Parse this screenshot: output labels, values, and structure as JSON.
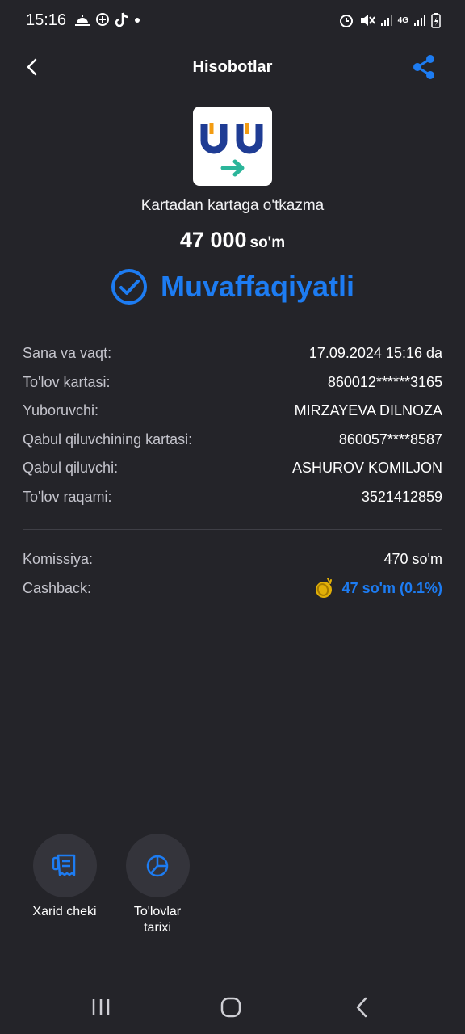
{
  "status_bar": {
    "time": "15:16",
    "network": "4G"
  },
  "header": {
    "title": "Hisobotlar"
  },
  "transaction": {
    "type": "Kartadan kartaga o'tkazma",
    "amount": "47 000",
    "currency": "so'm",
    "status": "Muvaffaqiyatli"
  },
  "details": [
    {
      "label": "Sana va vaqt:",
      "value": "17.09.2024 15:16 da"
    },
    {
      "label": "To'lov kartasi:",
      "value": "860012******3165"
    },
    {
      "label": "Yuboruvchi:",
      "value": "MIRZAYEVA DILNOZA"
    },
    {
      "label": "Qabul qiluvchining kartasi:",
      "value": "860057****8587"
    },
    {
      "label": "Qabul qiluvchi:",
      "value": "ASHUROV KOMILJON"
    },
    {
      "label": "To'lov raqami:",
      "value": "3521412859"
    }
  ],
  "fees": {
    "commission_label": "Komissiya:",
    "commission_value": "470 so'm",
    "cashback_label": "Cashback:",
    "cashback_value": "47 so'm (0.1%)"
  },
  "actions": {
    "receipt_label": "Xarid cheki",
    "history_label_1": "To'lovlar",
    "history_label_2": "tarixi"
  },
  "colors": {
    "background": "#242429",
    "accent": "#1d7cf2",
    "logo_blue": "#1f3c94",
    "logo_orange": "#f39c12",
    "logo_green": "#2bb59a",
    "coin": "#e2b007"
  },
  "icons": [
    "back-arrow-icon",
    "share-icon",
    "check-circle-icon",
    "coin-icon",
    "receipt-icon",
    "pie-chart-icon"
  ]
}
